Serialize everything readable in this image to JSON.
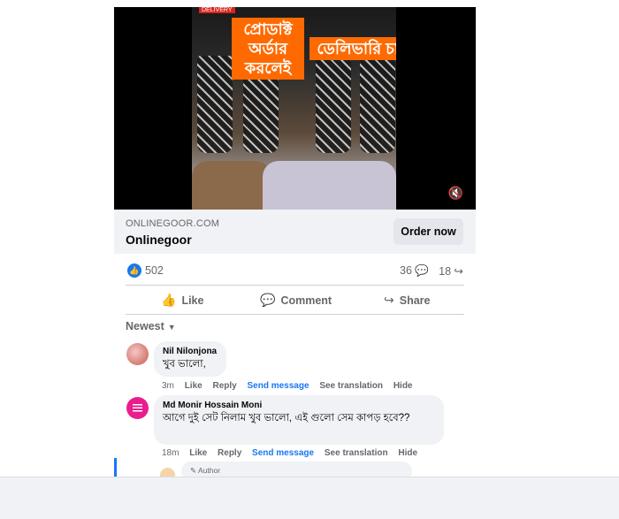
{
  "video": {
    "banner_line1": "প্রোডাক্ট অর্ডার করলেই",
    "banner_line2": "ডেলিভারি চার্জ ফ্রি",
    "tiny_badge": "DELIVERY",
    "mute_icon": "volume-mute-icon"
  },
  "link": {
    "domain": "ONLINEGOOR.COM",
    "title": "Onlinegoor",
    "cta": "Order now"
  },
  "stats": {
    "likes": "502",
    "comments": "36",
    "shares": "18"
  },
  "actions": {
    "like": "Like",
    "comment": "Comment",
    "share": "Share"
  },
  "sort": {
    "label": "Newest"
  },
  "comments": [
    {
      "author": "Nil Nilonjona",
      "text": "খুব ভালো,",
      "time": "3m",
      "like": "Like",
      "reply": "Reply",
      "send": "Send message",
      "translate": "See translation",
      "hide": "Hide"
    },
    {
      "author": "Md Monir Hossain Moni",
      "text": "আগে দুই সেট নিলাম খুব ভালো, এই গুলো সেম কাপড় হবে??",
      "time": "18m",
      "like": "Like",
      "reply": "Reply",
      "send": "Send message",
      "translate": "See translation",
      "hide": "Hide"
    }
  ],
  "reply": {
    "author_tag": "Author"
  },
  "colors": {
    "accent": "#1877f2",
    "banner": "#ff6a00",
    "surface": "#f0f2f5",
    "muted_text": "#65676b"
  }
}
